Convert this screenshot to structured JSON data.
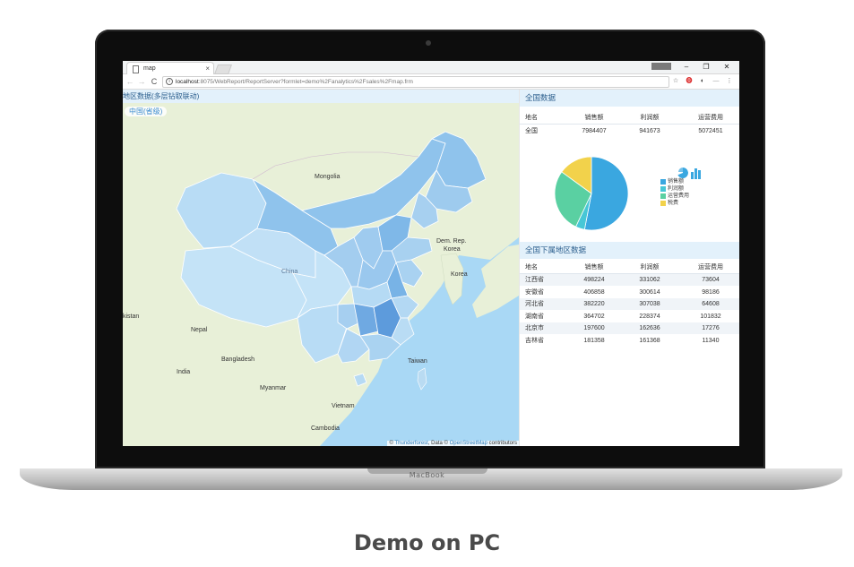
{
  "device": {
    "brand": "MacBook"
  },
  "caption": "Demo on PC",
  "browser": {
    "tab_title": "map",
    "tab_close": "×",
    "window_buttons": [
      "–",
      "❐",
      "✕"
    ],
    "url_host": "localhost",
    "url_rest": ":8075/WebReport/ReportServer?formlet=demo%2Fanalytics%2Fsales%2Fmap.frm",
    "nav": [
      "←",
      "→",
      "C"
    ],
    "extensions": [
      "☆",
      "⓿",
      "◐",
      "—",
      "⋮"
    ]
  },
  "map_panel": {
    "title": "地区数据(多层钻取联动)",
    "breadcrumb": "中国(省级)",
    "labels": {
      "mongolia": "Mongolia",
      "china": "China",
      "dem_rep": "Dem. Rep.",
      "korea_n": "Korea",
      "korea_s": "Korea",
      "kistan": "kistan",
      "nepal": "Nepal",
      "india": "India",
      "bangladesh": "Bangladesh",
      "myanmar": "Myanmar",
      "taiwan": "Taiwan",
      "vietnam": "Vietnam",
      "cambodia": "Cambodia"
    },
    "attribution": {
      "prefix": "©",
      "link1": "Thunderforest",
      "middle": ", Data ©",
      "link2": "OpenStreetMap",
      "suffix": "contributors"
    }
  },
  "national": {
    "title": "全国数据",
    "headers": [
      "地名",
      "销售额",
      "利润额",
      "运营费用"
    ],
    "row": [
      "全国",
      "7984407",
      "941673",
      "5072451"
    ]
  },
  "chart_data": {
    "type": "pie",
    "title": "",
    "categories": [
      "销售额",
      "利润额",
      "运营费用",
      "税费"
    ],
    "values": [
      53,
      4,
      28,
      15
    ],
    "colors": [
      "#3aa7e0",
      "#47c7d6",
      "#5ad0a2",
      "#f2d24b"
    ]
  },
  "regional": {
    "title": "全国下属地区数据",
    "headers": [
      "地名",
      "销售额",
      "利润额",
      "运营费用"
    ],
    "rows": [
      [
        "江西省",
        "498224",
        "331062",
        "73604"
      ],
      [
        "安徽省",
        "406858",
        "300614",
        "98186"
      ],
      [
        "河北省",
        "382220",
        "307038",
        "64608"
      ],
      [
        "湖南省",
        "364702",
        "228374",
        "101832"
      ],
      [
        "北京市",
        "197600",
        "162636",
        "17276"
      ],
      [
        "吉林省",
        "181358",
        "161368",
        "11340"
      ]
    ]
  },
  "colors": {
    "header_bg": "#e3f1fb",
    "header_text": "#2a5d8c",
    "sea": "#a9d8f5",
    "land": "#e8f0d8"
  }
}
